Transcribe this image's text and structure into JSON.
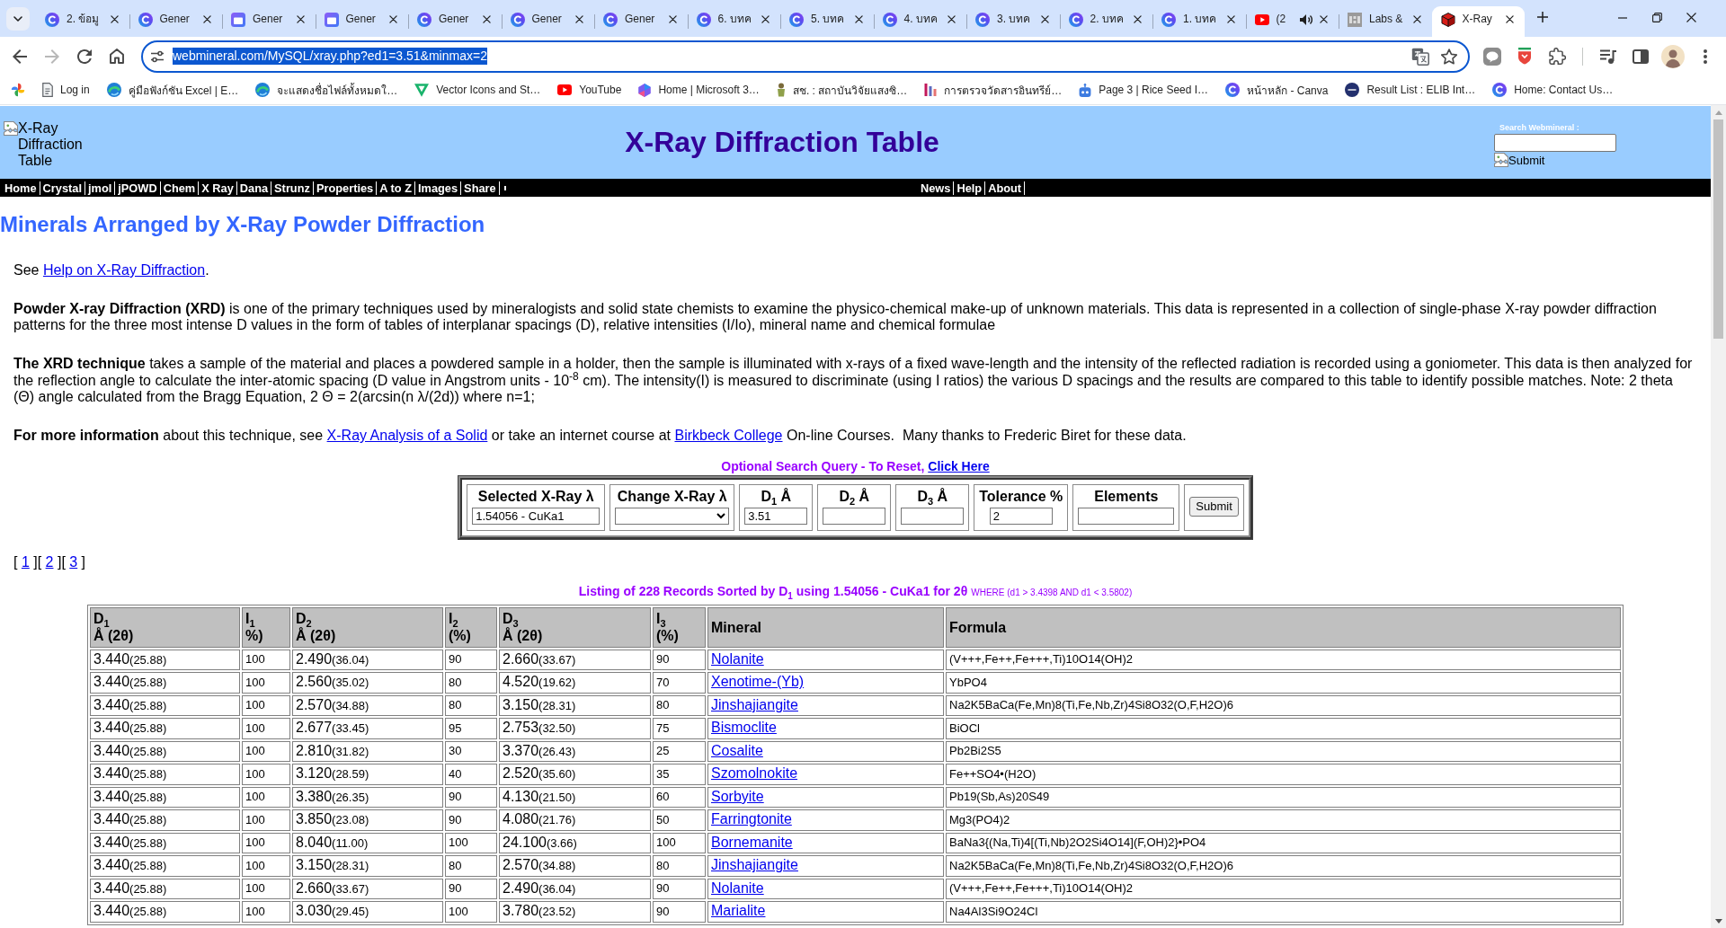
{
  "browser": {
    "tabs": [
      {
        "title": "2. ข้อมู",
        "kind": "round",
        "audio": false,
        "selected": false
      },
      {
        "title": "Gener",
        "kind": "round",
        "audio": false,
        "selected": false
      },
      {
        "title": "Gener",
        "kind": "window",
        "audio": false,
        "selected": false
      },
      {
        "title": "Gener",
        "kind": "window",
        "audio": false,
        "selected": false
      },
      {
        "title": "Gener",
        "kind": "round",
        "audio": false,
        "selected": false
      },
      {
        "title": "Gener",
        "kind": "round",
        "audio": false,
        "selected": false
      },
      {
        "title": "Gener",
        "kind": "round",
        "audio": false,
        "selected": false
      },
      {
        "title": "6. บทค",
        "kind": "round",
        "audio": false,
        "selected": false
      },
      {
        "title": "5. บทค",
        "kind": "round",
        "audio": false,
        "selected": false
      },
      {
        "title": "4. บทค",
        "kind": "round",
        "audio": false,
        "selected": false
      },
      {
        "title": "3. บทค",
        "kind": "round",
        "audio": false,
        "selected": false
      },
      {
        "title": "2. บทค",
        "kind": "round",
        "audio": false,
        "selected": false
      },
      {
        "title": "1. บทค",
        "kind": "round",
        "audio": false,
        "selected": false
      },
      {
        "title": "(2",
        "kind": "play",
        "audio": true,
        "selected": false
      },
      {
        "title": "Labs &",
        "kind": "tile",
        "audio": false,
        "selected": false
      },
      {
        "title": "X-Ray",
        "kind": "cube",
        "audio": false,
        "selected": true
      }
    ],
    "toolbar": {
      "back": {
        "disabled": false
      },
      "forward": {
        "disabled": true
      },
      "url": "webmineral.com/MySQL/xray.php?ed1=3.51&minmax=2",
      "url_selected": true
    },
    "bookmarks": [
      {
        "kind": "pinwheel"
      },
      {
        "kind": "document",
        "label": "Log in"
      },
      {
        "kind": "swirl",
        "label": "คู่มือฟังก์ชัน Excel | E…"
      },
      {
        "kind": "swirl",
        "label": "จะแสดงชื่อไฟล์ทั้งหมดใ…"
      },
      {
        "kind": "vector",
        "label": "Vector Icons and St…"
      },
      {
        "kind": "play",
        "label": "YouTube"
      },
      {
        "kind": "hexagon",
        "label": "Home | Microsoft 3…"
      },
      {
        "kind": "figure",
        "label": "สช. : สถาบันวิจัยแสงซิ…"
      },
      {
        "kind": "bars",
        "label": "การตรวจวัดสารอินทรีย์…"
      },
      {
        "kind": "robot",
        "label": "Page 3 | Rice Seed I…"
      },
      {
        "kind": "round",
        "label": "หน้าหลัก - Canva"
      },
      {
        "kind": "badge",
        "label": "Result List : ELIB Int…"
      },
      {
        "kind": "round",
        "label": "Home: Contact Us…"
      }
    ]
  },
  "site_header": {
    "logo_alt": "X-Ray Diffraction Table",
    "title": "X-Ray Diffraction Table",
    "search_label": "Search Webmineral :",
    "search_submit_alt": "Submit"
  },
  "nav": {
    "left": [
      "Home",
      "Crystal",
      "jmol",
      "jPOWD",
      "Chem",
      "X Ray",
      "Dana",
      "Strunz",
      "Properties",
      "A to Z",
      "Images",
      "Share"
    ],
    "right": [
      "News",
      "Help",
      "About"
    ]
  },
  "heading": "Minerals Arranged by X-Ray Powder Diffraction",
  "paragraphs": [
    {
      "parts": [
        {
          "kind": "text",
          "text": "See "
        },
        {
          "kind": "link",
          "text": "Help on X-Ray Diffraction"
        },
        {
          "kind": "text",
          "text": "."
        }
      ]
    },
    {
      "parts": [
        {
          "kind": "text",
          "text": "**Powder X-ray Diffraction (XRD)** is one of the primary techniques used by mineralogists and solid state chemists to examine the physico-chemical make-up of unknown materials. This data is represented in a collection of single-phase X-ray powder diffraction patterns for the three most intense D values in the form of tables of interplanar spacings (D), relative intensities (I/Io), mineral name and chemical formulae"
        }
      ]
    },
    {
      "parts": [
        {
          "kind": "text",
          "text": "**The XRD technique** takes a sample of the material and places a powdered sample in a holder, then the sample is illuminated with x-rays of a fixed wave-length and the intensity of the reflected radiation is recorded using a goniometer. This data is then analyzed for the reflection angle to calculate the inter-atomic spacing (D value in Angstrom units - 10$^{-8}$ cm). The intensity(I) is measured to discriminate (using I ratios) the various D spacings and the results are compared to this table to identify possible matches. Note: 2 theta (Θ) angle calculated from the Bragg Equation, 2 Θ = 2(arcsin(n λ/(2d)) where n=1;"
        }
      ]
    },
    {
      "parts": [
        {
          "kind": "text",
          "text": "**For more information** about this technique, see "
        },
        {
          "kind": "link",
          "text": "X-Ray Analysis of a Solid"
        },
        {
          "kind": "text",
          "text": " or take an internet course at "
        },
        {
          "kind": "link",
          "text": "Birkbeck College"
        },
        {
          "kind": "text",
          "text": " On-line Courses.  Many thanks to Frederic Biret for these data."
        }
      ]
    }
  ],
  "search": {
    "caption": "Optional Search Query - To Reset, ",
    "reset_link": "Click Here",
    "fields": [
      {
        "label": "Selected X-Ray λ",
        "kind": "text",
        "value": "1.54056 - CuKa1"
      },
      {
        "label": "Change X-Ray λ",
        "kind": "select"
      },
      {
        "label": "D$_{1}$ Å",
        "kind": "text",
        "value": "3.51"
      },
      {
        "label": "D$_{2}$ Å",
        "kind": "text"
      },
      {
        "label": "D$_{3}$ Å",
        "kind": "text"
      },
      {
        "label": "Tolerance %",
        "kind": "text",
        "value": "2"
      },
      {
        "label": "Elements",
        "kind": "text"
      }
    ],
    "submit": "Submit"
  },
  "pager": {
    "open": "[",
    "close": "]",
    "pages": [
      "1",
      "2",
      "3"
    ]
  },
  "listing": {
    "summary": "Listing of 228 Records Sorted by D$_{1}$ using 1.54056 - CuKa1 for 2θ",
    "condition": "WHERE (d1 > 3.4398 AND d1 < 3.5802)"
  },
  "table": {
    "columns": [
      {
        "label": "D$_{1}$",
        "unit": "Å (2θ)"
      },
      {
        "label": "I$_{1}$",
        "unit": "%)"
      },
      {
        "label": "D$_{2}$",
        "unit": "Å (2θ)"
      },
      {
        "label": "I$_{2}$",
        "unit": "(%)"
      },
      {
        "label": "D$_{3}$",
        "unit": "Å (2θ)"
      },
      {
        "label": "I$_{3}$",
        "unit": "(%)"
      },
      {
        "label": "Mineral"
      },
      {
        "label": "Formula"
      }
    ],
    "rows": [
      {
        "d1": "3.440",
        "d1_angle": "(25.88)",
        "i1": "100",
        "d2": "2.490",
        "d2_angle": "(36.04)",
        "i2": "90",
        "d3": "2.660",
        "d3_angle": "(33.67)",
        "i3": "90",
        "mineral": "Nolanite",
        "formula": "(V+++,Fe++,Fe+++,Ti)10O14(OH)2"
      },
      {
        "d1": "3.440",
        "d1_angle": "(25.88)",
        "i1": "100",
        "d2": "2.560",
        "d2_angle": "(35.02)",
        "i2": "80",
        "d3": "4.520",
        "d3_angle": "(19.62)",
        "i3": "70",
        "mineral": "Xenotime-(Yb)",
        "formula": "YbPO4"
      },
      {
        "d1": "3.440",
        "d1_angle": "(25.88)",
        "i1": "100",
        "d2": "2.570",
        "d2_angle": "(34.88)",
        "i2": "80",
        "d3": "3.150",
        "d3_angle": "(28.31)",
        "i3": "80",
        "mineral": "Jinshajiangite",
        "formula": "Na2K5BaCa(Fe,Mn)8(Ti,Fe,Nb,Zr)4Si8O32(O,F,H2O)6"
      },
      {
        "d1": "3.440",
        "d1_angle": "(25.88)",
        "i1": "100",
        "d2": "2.677",
        "d2_angle": "(33.45)",
        "i2": "95",
        "d3": "2.753",
        "d3_angle": "(32.50)",
        "i3": "75",
        "mineral": "Bismoclite",
        "formula": "BiOCl"
      },
      {
        "d1": "3.440",
        "d1_angle": "(25.88)",
        "i1": "100",
        "d2": "2.810",
        "d2_angle": "(31.82)",
        "i2": "30",
        "d3": "3.370",
        "d3_angle": "(26.43)",
        "i3": "25",
        "mineral": "Cosalite",
        "formula": "Pb2Bi2S5"
      },
      {
        "d1": "3.440",
        "d1_angle": "(25.88)",
        "i1": "100",
        "d2": "3.120",
        "d2_angle": "(28.59)",
        "i2": "40",
        "d3": "2.520",
        "d3_angle": "(35.60)",
        "i3": "35",
        "mineral": "Szomolnokite",
        "formula": "Fe++SO4•(H2O)"
      },
      {
        "d1": "3.440",
        "d1_angle": "(25.88)",
        "i1": "100",
        "d2": "3.380",
        "d2_angle": "(26.35)",
        "i2": "90",
        "d3": "4.130",
        "d3_angle": "(21.50)",
        "i3": "60",
        "mineral": "Sorbyite",
        "formula": "Pb19(Sb,As)20S49"
      },
      {
        "d1": "3.440",
        "d1_angle": "(25.88)",
        "i1": "100",
        "d2": "3.850",
        "d2_angle": "(23.08)",
        "i2": "90",
        "d3": "4.080",
        "d3_angle": "(21.76)",
        "i3": "50",
        "mineral": "Farringtonite",
        "formula": "Mg3(PO4)2"
      },
      {
        "d1": "3.440",
        "d1_angle": "(25.88)",
        "i1": "100",
        "d2": "8.040",
        "d2_angle": "(11.00)",
        "i2": "100",
        "d3": "24.100",
        "d3_angle": "(3.66)",
        "i3": "100",
        "mineral": "Bornemanite",
        "formula": "BaNa3{(Na,Ti)4[(Ti,Nb)2O2Si4O14](F,OH)2}•PO4"
      },
      {
        "d1": "3.440",
        "d1_angle": "(25.88)",
        "i1": "100",
        "d2": "3.150",
        "d2_angle": "(28.31)",
        "i2": "80",
        "d3": "2.570",
        "d3_angle": "(34.88)",
        "i3": "80",
        "mineral": "Jinshajiangite",
        "formula": "Na2K5BaCa(Fe,Mn)8(Ti,Fe,Nb,Zr)4Si8O32(O,F,H2O)6"
      },
      {
        "d1": "3.440",
        "d1_angle": "(25.88)",
        "i1": "100",
        "d2": "2.660",
        "d2_angle": "(33.67)",
        "i2": "90",
        "d3": "2.490",
        "d3_angle": "(36.04)",
        "i3": "90",
        "mineral": "Nolanite",
        "formula": "(V+++,Fe++,Fe+++,Ti)10O14(OH)2"
      },
      {
        "d1": "3.440",
        "d1_angle": "(25.88)",
        "i1": "100",
        "d2": "3.030",
        "d2_angle": "(29.45)",
        "i2": "100",
        "d3": "3.780",
        "d3_angle": "(23.52)",
        "i3": "90",
        "mineral": "Marialite",
        "formula": "Na4Al3Si9O24Cl"
      }
    ]
  }
}
